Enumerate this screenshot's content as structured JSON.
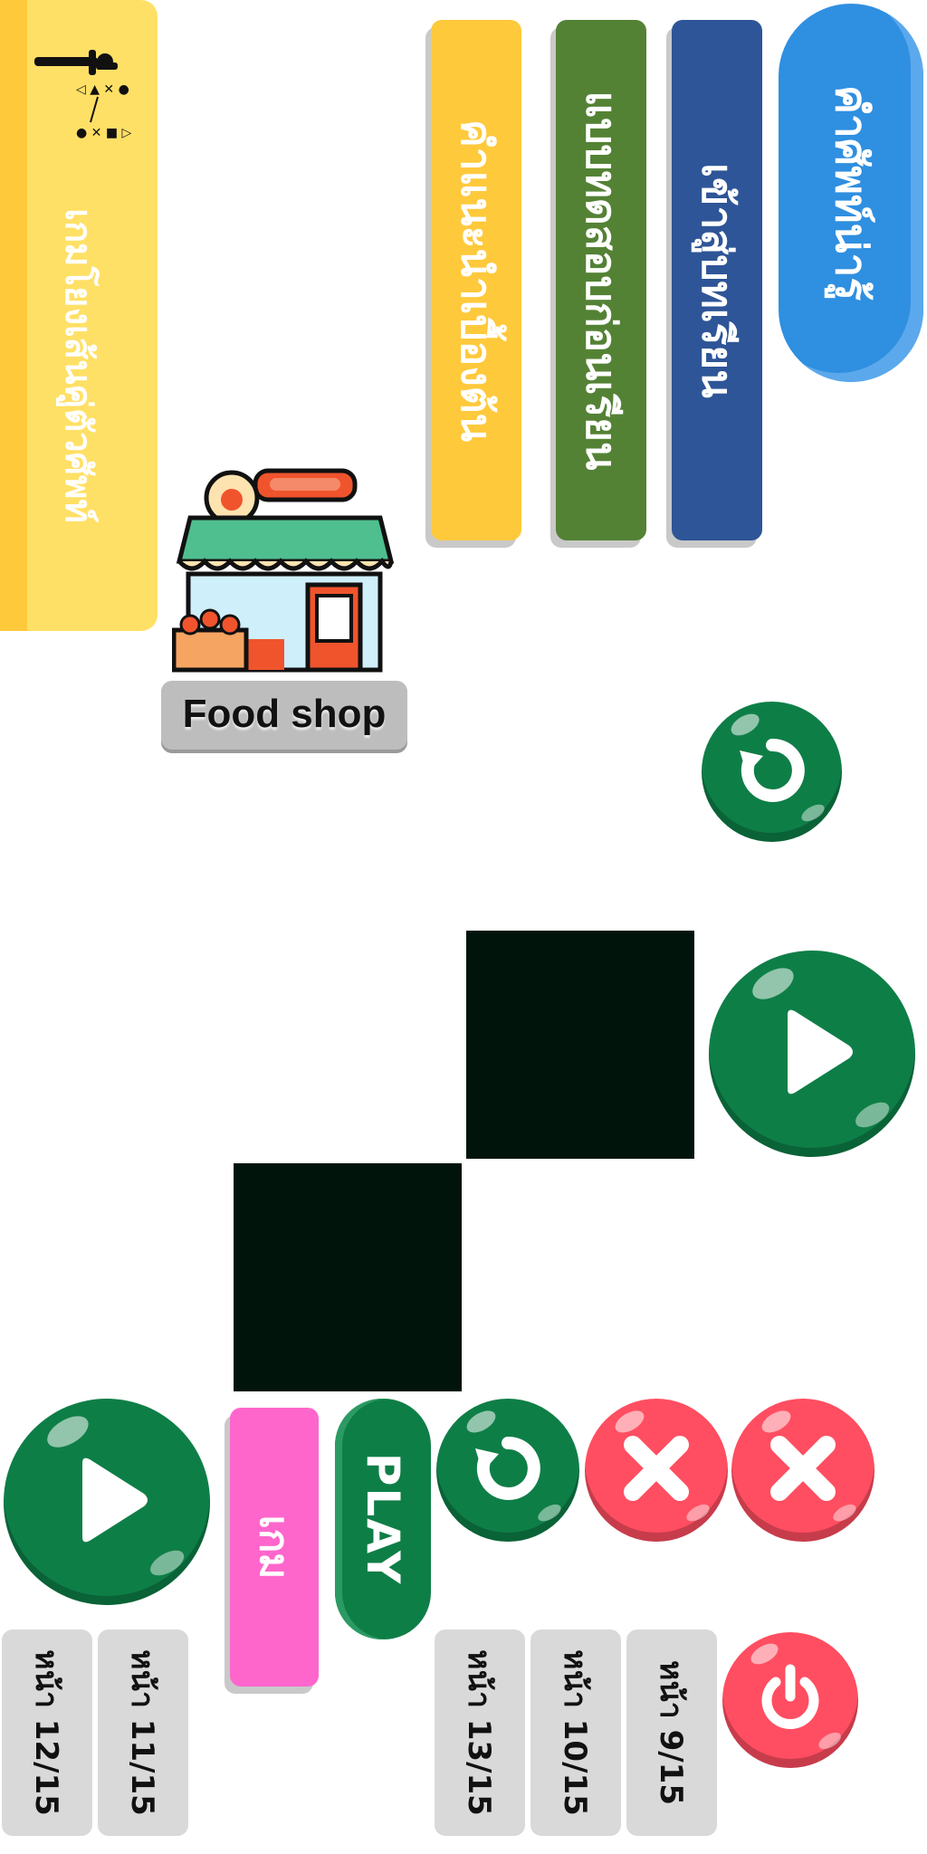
{
  "banner": {
    "title": "เกมโยงเส้นคู่ตัวศัพท์"
  },
  "menu": {
    "vocab_button": "คำศัพท์น่ารู้",
    "enter_lesson": "เข้าสู่บทเรียน",
    "pretest": "แบบทดสอบก่อนเรียน",
    "intro_advice": "คำแนะนำเบื้องต้น"
  },
  "shop": {
    "label": "Food shop"
  },
  "game": {
    "play_label": "PLAY",
    "game_label": "เกม"
  },
  "pages": {
    "p9": "หน้า 9/15",
    "p10": "หน้า 10/15",
    "p11": "หน้า 11/15",
    "p12": "หน้า 12/15",
    "p13": "หน้า 13/15"
  },
  "colors": {
    "banner_yellow": "#FFE066",
    "blue": "#2F8FE0",
    "navy": "#2E5597",
    "olive_green": "#548235",
    "yellow": "#FFC93C",
    "pink": "#FF66CC",
    "green": "#0E7E47",
    "red": "#FF4E61",
    "gray": "#D9D9D9",
    "black": "#00140C"
  },
  "icons": {
    "strategy": "strategy-icon",
    "shop": "shop-icon",
    "replay": "replay-icon",
    "play": "play-icon",
    "close": "close-icon",
    "power": "power-icon"
  }
}
